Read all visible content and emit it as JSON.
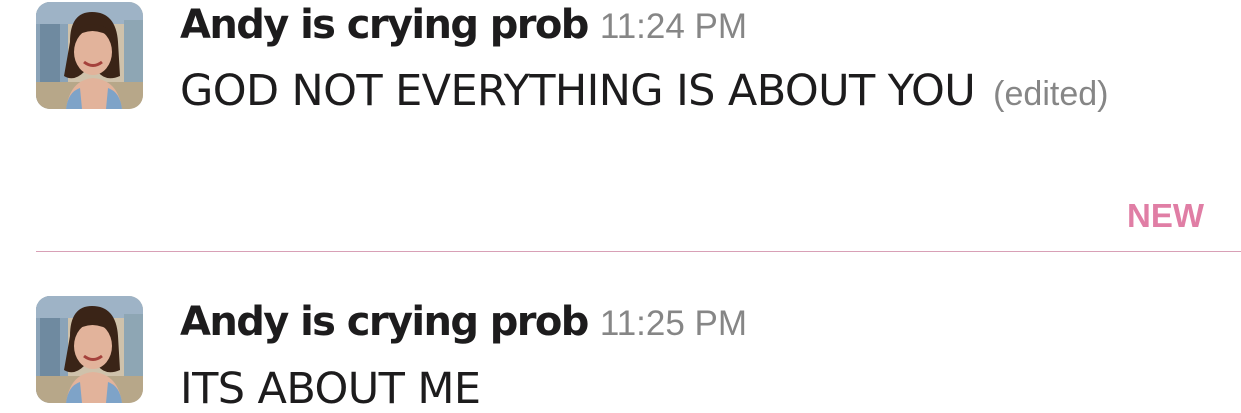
{
  "messages": [
    {
      "sender": "Andy is crying prob",
      "time": "11:24 PM",
      "text": "GOD NOT EVERYTHING IS ABOUT YOU",
      "edited_label": "(edited)",
      "avatar_icon": "user-photo-avatar"
    },
    {
      "sender": "Andy is crying prob",
      "time": "11:25 PM",
      "text": "ITS ABOUT ME",
      "avatar_icon": "user-photo-avatar"
    }
  ],
  "divider": {
    "label": "NEW",
    "color": "#e07ea5",
    "line_color": "#d8a0b6"
  },
  "colors": {
    "text": "#1d1c1d",
    "muted": "#868686",
    "background": "#ffffff"
  }
}
